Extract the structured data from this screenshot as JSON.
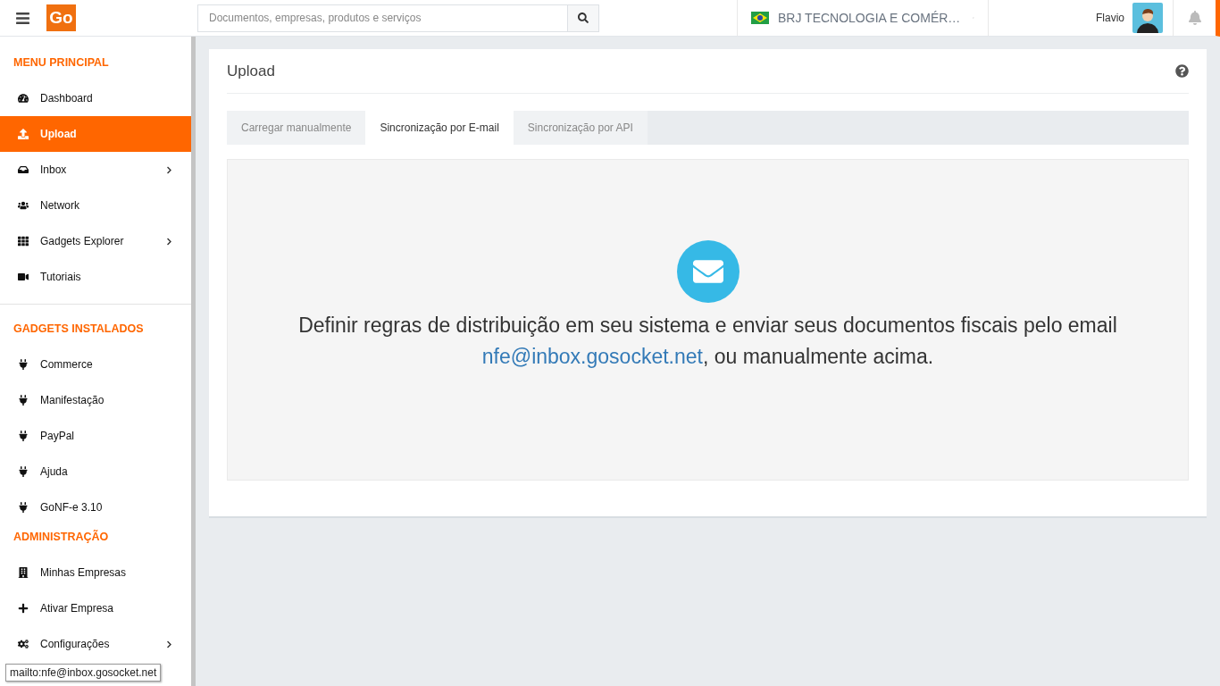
{
  "header": {
    "logo": "Go",
    "search": {
      "placeholder": "Documentos, empresas, produtos e serviços"
    },
    "company": "BRJ TECNOLOGIA E COMÉR…",
    "user": "Flavio"
  },
  "sidebar": {
    "sections": [
      {
        "title": "MENU PRINCIPAL",
        "items": [
          {
            "label": "Dashboard",
            "selected": false,
            "expandable": false
          },
          {
            "label": "Upload",
            "selected": true,
            "expandable": false
          },
          {
            "label": "Inbox",
            "selected": false,
            "expandable": true
          },
          {
            "label": "Network",
            "selected": false,
            "expandable": false
          },
          {
            "label": "Gadgets Explorer",
            "selected": false,
            "expandable": true
          },
          {
            "label": "Tutoriais",
            "selected": false,
            "expandable": false
          }
        ]
      },
      {
        "title": "GADGETS INSTALADOS",
        "items": [
          {
            "label": "Commerce",
            "selected": false,
            "expandable": false
          },
          {
            "label": "Manifestação",
            "selected": false,
            "expandable": false
          },
          {
            "label": "PayPal",
            "selected": false,
            "expandable": false
          },
          {
            "label": "Ajuda",
            "selected": false,
            "expandable": false
          },
          {
            "label": "GoNF-e 3.10",
            "selected": false,
            "expandable": false
          }
        ]
      },
      {
        "title": "ADMINISTRAÇÃO",
        "items": [
          {
            "label": "Minhas Empresas",
            "selected": false,
            "expandable": false
          },
          {
            "label": "Ativar Empresa",
            "selected": false,
            "expandable": false
          },
          {
            "label": "Configurações",
            "selected": false,
            "expandable": true
          }
        ]
      }
    ]
  },
  "panel": {
    "title": "Upload",
    "tabs": [
      {
        "label": "Carregar manualmente",
        "selected": false
      },
      {
        "label": "Sincronização por E-mail",
        "selected": true
      },
      {
        "label": "Sincronização por API",
        "selected": false
      }
    ],
    "message": "Definir regras de distribuição em seu sistema e enviar seus documentos fiscais pelo email",
    "email": "nfe@inbox.gosocket.net",
    "message_end": ", ou manualmente acima."
  },
  "status_tooltip": "mailto:nfe@inbox.gosocket.net"
}
